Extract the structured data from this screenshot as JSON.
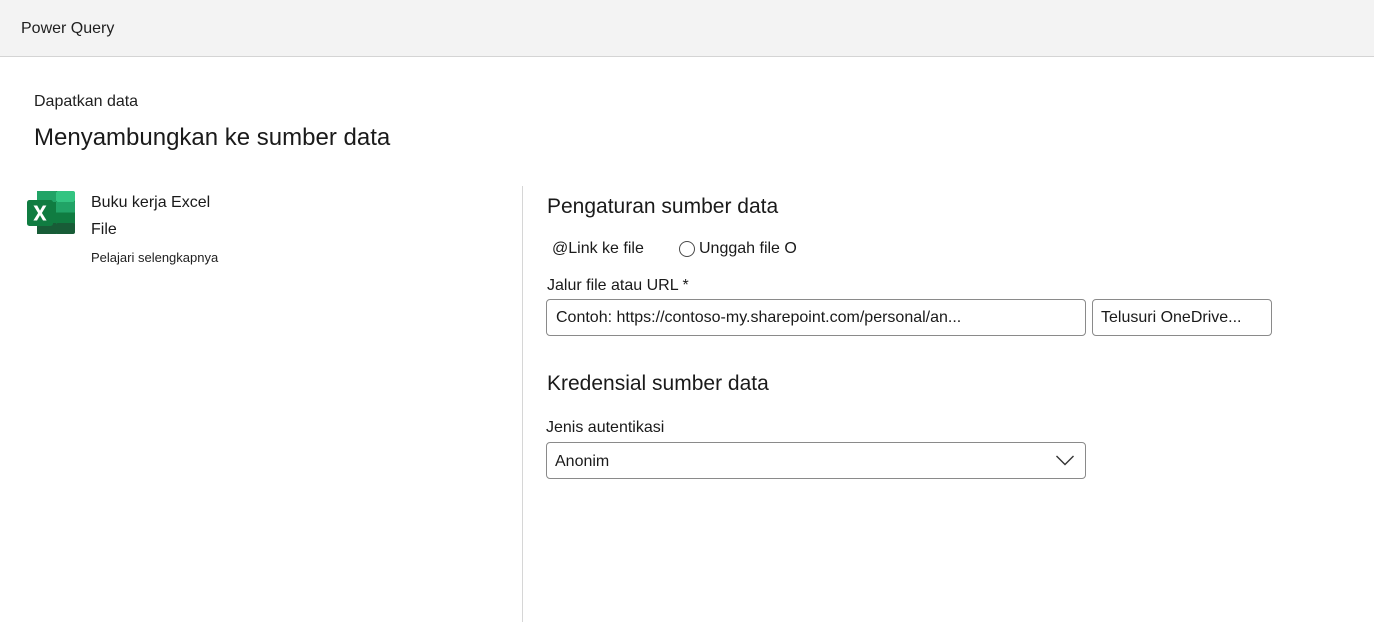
{
  "app": {
    "title": "Power Query"
  },
  "header": {
    "breadcrumb": "Dapatkan data",
    "title": "Menyambungkan ke sumber data"
  },
  "connector": {
    "icon": "excel-logo-icon",
    "name": "Buku kerja Excel",
    "type": "File",
    "learn_more": "Pelajari selengkapnya",
    "colors": {
      "dark": "#185c37",
      "mid": "#21a366",
      "light": "#33c481",
      "base": "#107c41"
    }
  },
  "settings": {
    "title": "Pengaturan sumber data",
    "options": [
      {
        "label": "@Link ke file",
        "selected": true
      },
      {
        "label": "Unggah file O",
        "selected": false
      }
    ],
    "path_label": "Jalur file atau URL *",
    "path_placeholder": "Contoh: https://contoso-my.sharepoint.com/personal/an...",
    "path_value": "",
    "browse_label": "Telusuri OneDrive..."
  },
  "credentials": {
    "title": "Kredensial sumber data",
    "auth_label": "Jenis autentikasi",
    "auth_value": "Anonim"
  }
}
